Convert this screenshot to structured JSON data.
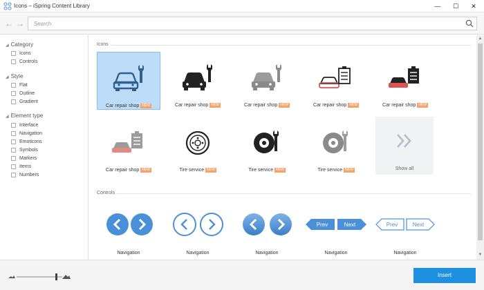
{
  "window": {
    "title": "Icons – iSpring Content Library"
  },
  "search": {
    "placeholder": "Search",
    "value": ""
  },
  "sidebar": {
    "groups": [
      {
        "title": "Category",
        "items": [
          "Icons",
          "Controls"
        ]
      },
      {
        "title": "Style",
        "items": [
          "Flat",
          "Outline",
          "Gradient"
        ]
      },
      {
        "title": "Element type",
        "items": [
          "Interface",
          "Navigation",
          "Emoticons",
          "Symbols",
          "Markers",
          "Items",
          "Numbers"
        ]
      }
    ]
  },
  "content": {
    "icons_section": "Icons",
    "controls_section": "Controls",
    "new_badge": "NEW",
    "icons": [
      {
        "label": "Car repair shop",
        "icon": "car-wrench-icon",
        "style": "flat-selected"
      },
      {
        "label": "Car repair shop",
        "icon": "car-wrench-icon",
        "style": "dark"
      },
      {
        "label": "Car repair shop",
        "icon": "car-wrench-icon",
        "style": "gray"
      },
      {
        "label": "Car repair shop",
        "icon": "car-clipboard-icon",
        "style": "outline"
      },
      {
        "label": "Car repair shop",
        "icon": "car-clipboard-icon",
        "style": "dark"
      },
      {
        "label": "Car repair shop",
        "icon": "car-clipboard-icon",
        "style": "gray"
      },
      {
        "label": "Tire service",
        "icon": "tire-icon",
        "style": "outline"
      },
      {
        "label": "Tire service",
        "icon": "tire-wrench-icon",
        "style": "dark"
      },
      {
        "label": "Tire service",
        "icon": "tire-wrench-icon",
        "style": "gray"
      }
    ],
    "show_all": "Show all",
    "controls": [
      {
        "label": "Navigation",
        "variant": "filled-circles"
      },
      {
        "label": "Navigation",
        "variant": "outline-circles"
      },
      {
        "label": "Navigation",
        "variant": "gradient-circles"
      },
      {
        "label": "Navigation",
        "variant": "filled-prev-next",
        "prev": "Prev",
        "next": "Next"
      },
      {
        "label": "Navigation",
        "variant": "outline-prev-next",
        "prev": "Prev",
        "next": "Next"
      }
    ]
  },
  "footer": {
    "insert_label": "Insert"
  },
  "colors": {
    "accent": "#1e90e0",
    "selected_tile": "#bcdcf7",
    "new_badge": "#f4a36b",
    "nav_blue": "#4a90d9"
  }
}
